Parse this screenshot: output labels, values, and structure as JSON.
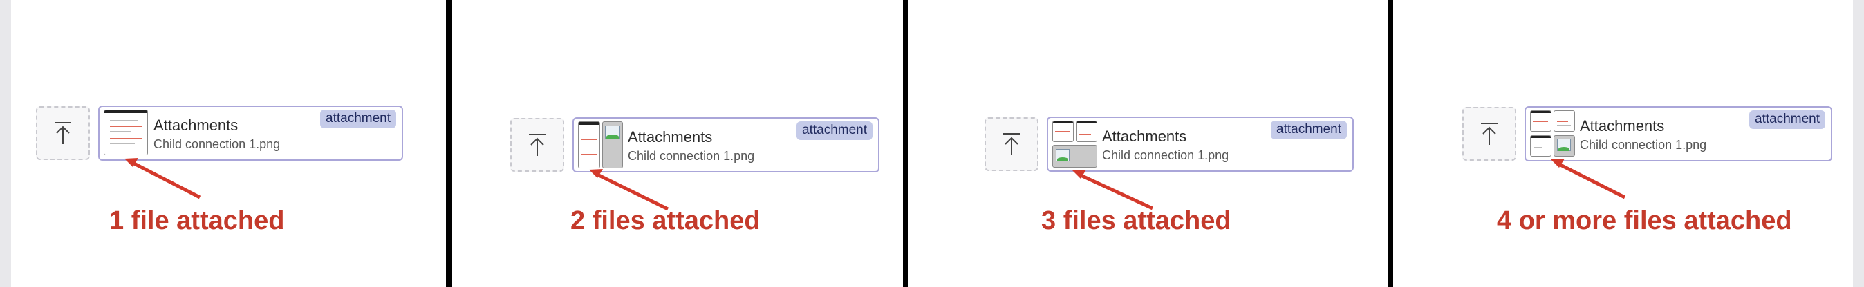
{
  "panels": [
    {
      "attachment_title": "Attachments",
      "attachment_filename": "Child connection 1.png",
      "badge_label": "attachment",
      "caption": "1 file attached"
    },
    {
      "attachment_title": "Attachments",
      "attachment_filename": "Child connection 1.png",
      "badge_label": "attachment",
      "caption": "2 files attached"
    },
    {
      "attachment_title": "Attachments",
      "attachment_filename": "Child connection 1.png",
      "badge_label": "attachment",
      "caption": "3 files attached"
    },
    {
      "attachment_title": "Attachments",
      "attachment_filename": "Child connection 1.png",
      "badge_label": "attachment",
      "caption": "4 or more files attached"
    }
  ],
  "icons": {
    "upload": "upload-arrow-icon",
    "pointer": "red-arrow-icon"
  },
  "colors": {
    "card_border": "#aaa6d9",
    "badge_bg": "#c5cbe9",
    "caption": "#c43a2b",
    "arrow": "#d4392b"
  }
}
